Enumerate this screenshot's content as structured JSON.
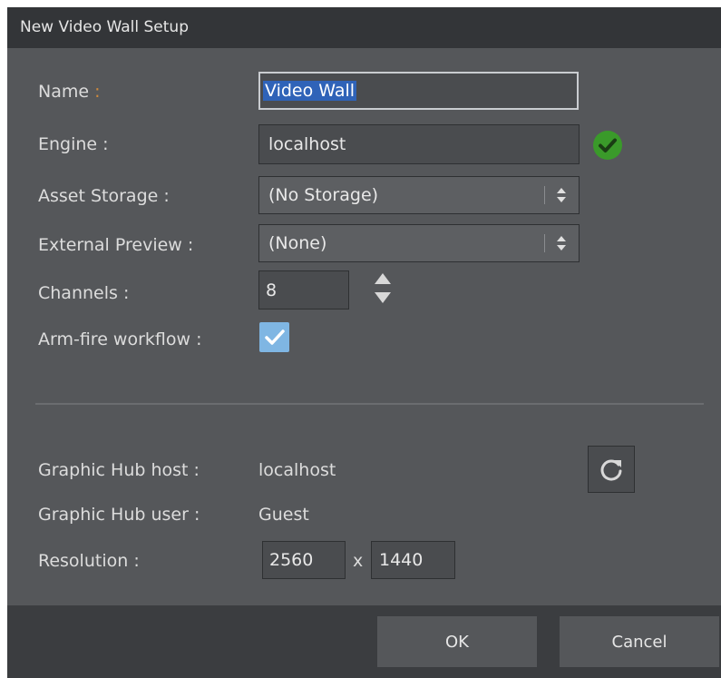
{
  "window": {
    "title": "New Video Wall Setup"
  },
  "form": {
    "name": {
      "label": "Name",
      "colon": " :",
      "value": "Video Wall"
    },
    "engine": {
      "label": "Engine :",
      "value": "localhost",
      "status_icon": "check-circle-icon",
      "status_color": "#3a9a2a"
    },
    "asset_storage": {
      "label": "Asset Storage :",
      "value": "(No Storage)"
    },
    "external_preview": {
      "label": "External Preview :",
      "value": "(None)"
    },
    "channels": {
      "label": "Channels :",
      "value": "8"
    },
    "arm_fire": {
      "label": "Arm-fire workflow :",
      "checked": true
    }
  },
  "hub": {
    "host_label": "Graphic Hub host :",
    "host_value": "localhost",
    "user_label": "Graphic Hub user :",
    "user_value": "Guest",
    "resolution_label": "Resolution :",
    "res_width": "2560",
    "res_separator": "x",
    "res_height": "1440",
    "refresh_icon": "refresh-icon"
  },
  "buttons": {
    "ok": "OK",
    "cancel": "Cancel"
  },
  "colors": {
    "dialog_bg": "#55575a",
    "titlebar_bg": "#333538",
    "footer_bg": "#3b3d40",
    "selection": "#2f63b8",
    "checkbox": "#7fb6e3",
    "ok_status": "#3a9a2a"
  }
}
